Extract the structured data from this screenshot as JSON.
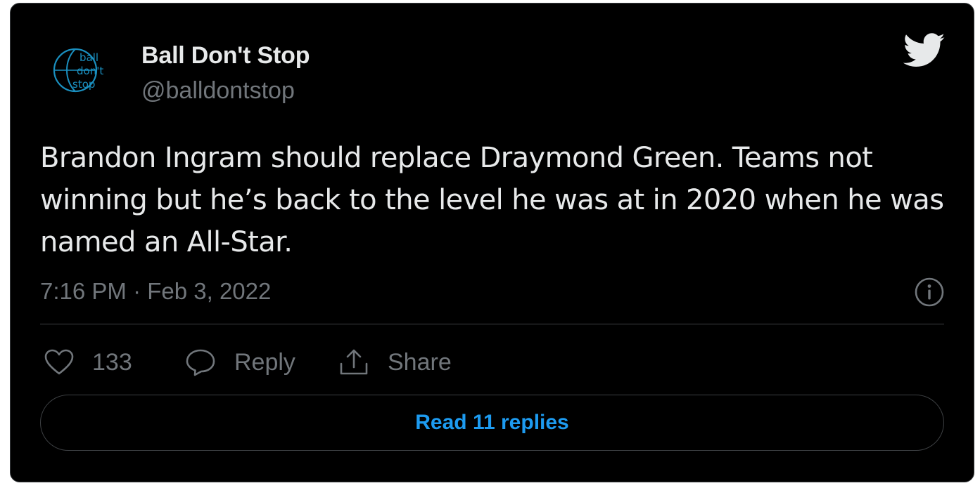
{
  "author": {
    "display_name": "Ball Don't Stop",
    "handle": "@balldontstop",
    "avatar_icon": "ball-dont-stop-logo",
    "avatar_text_lines": [
      "ball",
      "don't",
      "stop"
    ]
  },
  "platform_icon": "twitter-bird-icon",
  "tweet": {
    "text": "Brandon Ingram should replace Draymond Green. Teams not winning but he’s back to the level he was at in 2020 when he was named an All-Star.",
    "timestamp": "7:16 PM · Feb 3, 2022"
  },
  "actions": {
    "like_count": "133",
    "reply_label": "Reply",
    "share_label": "Share"
  },
  "read_replies_label": "Read 11 replies",
  "colors": {
    "background": "#000000",
    "text_primary": "#e7e9ea",
    "text_secondary": "#71767b",
    "accent": "#1d9bf0",
    "border": "#3d4043",
    "logo": "#1a8fbf"
  }
}
